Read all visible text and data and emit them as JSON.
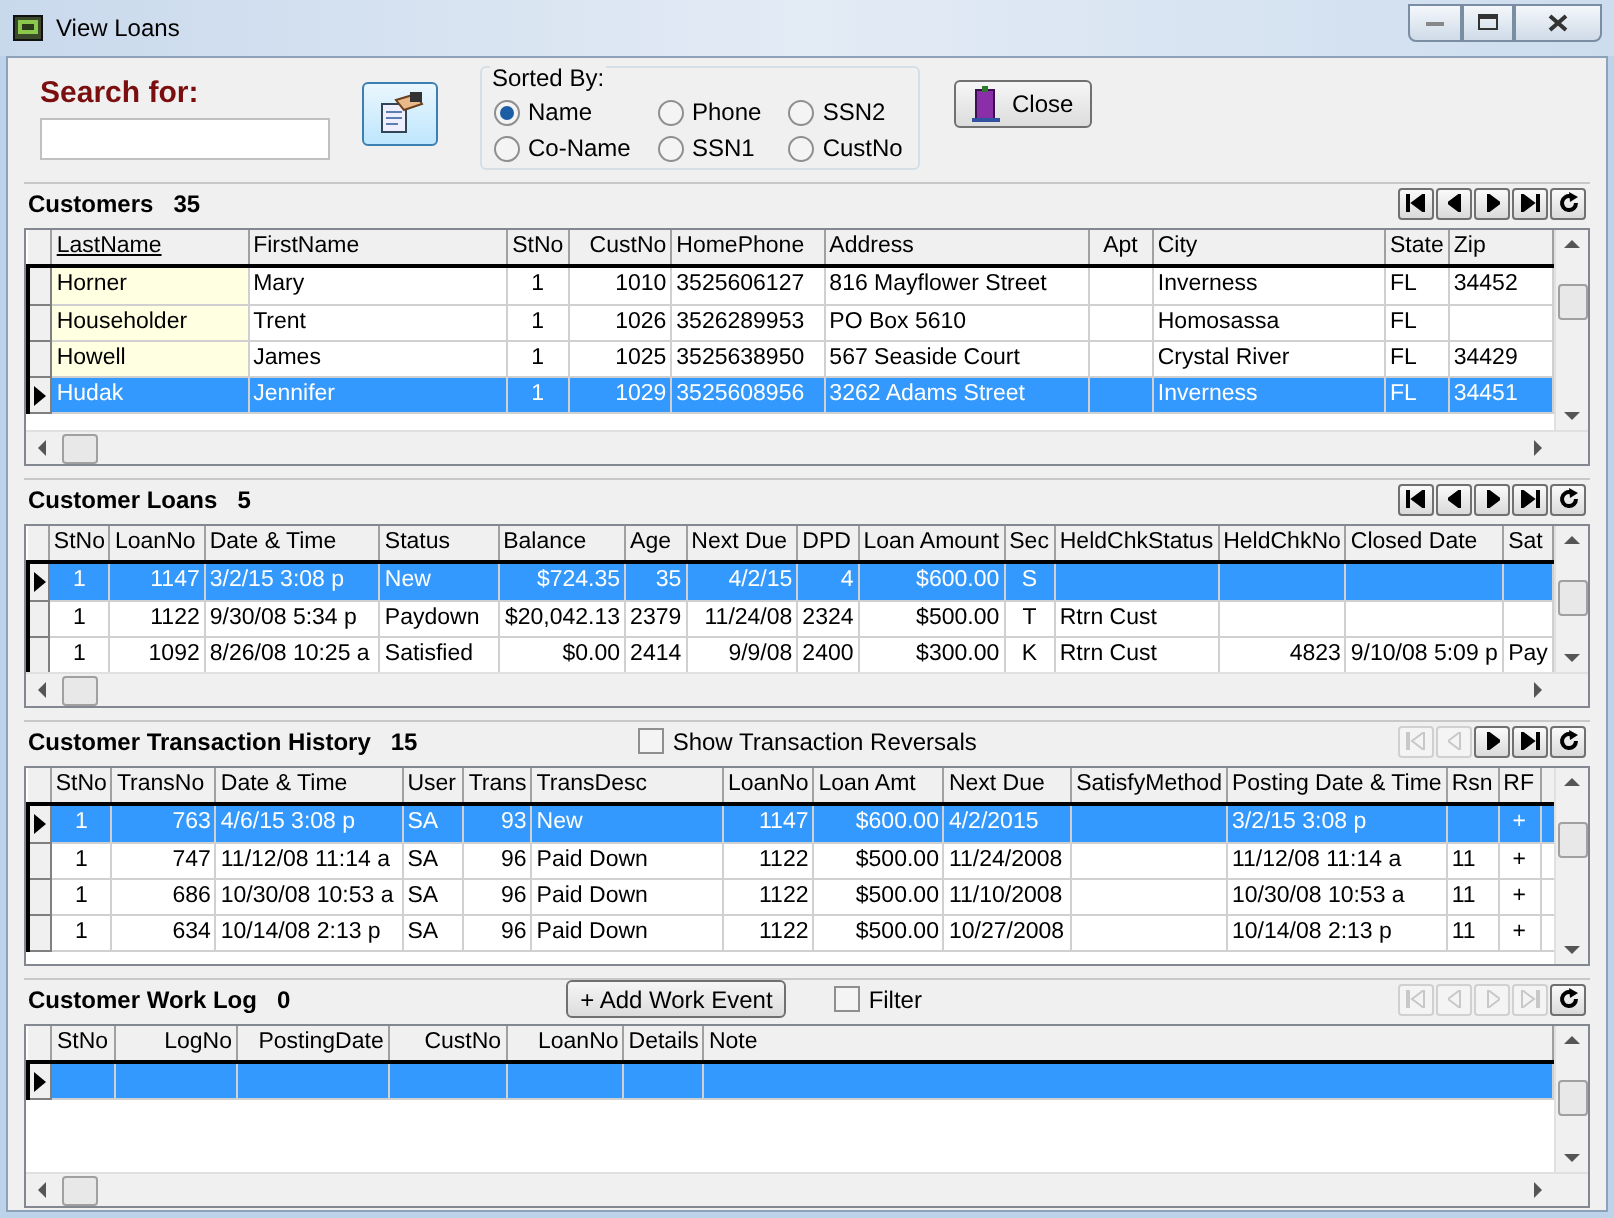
{
  "window": {
    "title": "View Loans"
  },
  "search": {
    "label": "Search for:"
  },
  "sort_group": {
    "title": "Sorted By:",
    "options": [
      {
        "label": "Name",
        "selected": true
      },
      {
        "label": "Co-Name",
        "selected": false
      },
      {
        "label": "Phone",
        "selected": false
      },
      {
        "label": "SSN1",
        "selected": false
      },
      {
        "label": "SSN2",
        "selected": false
      },
      {
        "label": "CustNo",
        "selected": false
      }
    ]
  },
  "close_button": {
    "label": "Close"
  },
  "sections": [
    {
      "title": "Customers",
      "count": "35",
      "nav": [
        {
          "kind": "first",
          "disabled": false
        },
        {
          "kind": "prev",
          "disabled": false
        },
        {
          "kind": "next",
          "disabled": false
        },
        {
          "kind": "last",
          "disabled": false
        },
        {
          "kind": "refresh",
          "disabled": false
        }
      ],
      "columns": [
        {
          "label": "LastName",
          "sorted": true
        },
        {
          "label": "FirstName",
          "sorted": false
        },
        {
          "label": "StNo",
          "sorted": false
        },
        {
          "label": "CustNo",
          "sorted": false
        },
        {
          "label": "HomePhone",
          "sorted": false
        },
        {
          "label": "Address",
          "sorted": false
        },
        {
          "label": "Apt",
          "sorted": false
        },
        {
          "label": "City",
          "sorted": false
        },
        {
          "label": "State",
          "sorted": false
        },
        {
          "label": "Zip",
          "sorted": false
        }
      ],
      "rows": [
        {
          "selected": false,
          "cells": [
            "Horner",
            "Mary",
            "1",
            "1010",
            "3525606127",
            "816 Mayflower Street",
            null,
            "Inverness",
            "FL",
            "34452"
          ]
        },
        {
          "selected": false,
          "cells": [
            "Householder",
            "Trent",
            "1",
            "1026",
            "3526289953",
            "PO Box 5610",
            null,
            "Homosassa",
            "FL",
            null
          ]
        },
        {
          "selected": false,
          "cells": [
            "Howell",
            "James",
            "1",
            "1025",
            "3525638950",
            "567 Seaside Court",
            null,
            "Crystal River",
            "FL",
            "34429"
          ]
        },
        {
          "selected": true,
          "cells": [
            "Hudak",
            "Jennifer",
            "1",
            "1029",
            "3525608956",
            "3262 Adams Street",
            null,
            "Inverness",
            "FL",
            "34451"
          ]
        }
      ]
    },
    {
      "title": "Customer Loans",
      "count": "5",
      "nav": [
        {
          "kind": "first",
          "disabled": false
        },
        {
          "kind": "prev",
          "disabled": false
        },
        {
          "kind": "next",
          "disabled": false
        },
        {
          "kind": "last",
          "disabled": false
        },
        {
          "kind": "refresh",
          "disabled": false
        }
      ],
      "columns": [
        {
          "label": "StNo"
        },
        {
          "label": "LoanNo"
        },
        {
          "label": "Date & Time"
        },
        {
          "label": "Status"
        },
        {
          "label": "Balance"
        },
        {
          "label": "Age"
        },
        {
          "label": "Next Due"
        },
        {
          "label": "DPD"
        },
        {
          "label": "Loan Amount"
        },
        {
          "label": "Sec"
        },
        {
          "label": "HeldChkStatus"
        },
        {
          "label": "HeldChkNo"
        },
        {
          "label": "Closed Date"
        },
        {
          "label": "Sat"
        }
      ],
      "rows": [
        {
          "selected": true,
          "cells": [
            "1",
            "1147",
            "3/2/15 3:08 p",
            "New",
            "$724.35",
            "35",
            "4/2/15",
            "4",
            "$600.00",
            "S",
            null,
            null,
            null,
            null
          ]
        },
        {
          "selected": false,
          "cells": [
            "1",
            "1122",
            "9/30/08 5:34 p",
            "Paydown",
            "$20,042.13",
            "2379",
            "11/24/08",
            "2324",
            "$500.00",
            "T",
            "Rtrn Cust",
            null,
            null,
            null
          ]
        },
        {
          "selected": false,
          "cells": [
            "1",
            "1092",
            "8/26/08 10:25 a",
            "Satisfied",
            "$0.00",
            "2414",
            "9/9/08",
            "2400",
            "$300.00",
            "K",
            "Rtrn Cust",
            "4823",
            "9/10/08 5:09 p",
            "Pay"
          ]
        }
      ]
    },
    {
      "title": "Customer Transaction History",
      "count": "15",
      "controls": [
        {
          "kind": "checkbox",
          "label": "Show Transaction Reversals",
          "checked": false
        }
      ],
      "nav": [
        {
          "kind": "first",
          "disabled": true
        },
        {
          "kind": "prev",
          "disabled": true
        },
        {
          "kind": "next",
          "disabled": false
        },
        {
          "kind": "last",
          "disabled": false
        },
        {
          "kind": "refresh",
          "disabled": false
        }
      ],
      "columns": [
        {
          "label": "StNo"
        },
        {
          "label": "TransNo"
        },
        {
          "label": "Date & Time"
        },
        {
          "label": "User"
        },
        {
          "label": "Trans"
        },
        {
          "label": "TransDesc"
        },
        {
          "label": "LoanNo"
        },
        {
          "label": "Loan Amt"
        },
        {
          "label": "Next Due"
        },
        {
          "label": "SatisfyMethod"
        },
        {
          "label": "Posting Date & Time"
        },
        {
          "label": "Rsn"
        },
        {
          "label": "RF"
        }
      ],
      "rows": [
        {
          "selected": true,
          "cells": [
            "1",
            "763",
            "4/6/15 3:08 p",
            "SA",
            "93",
            "New",
            "1147",
            "$600.00",
            "4/2/2015",
            null,
            "3/2/15 3:08 p",
            null,
            "+"
          ]
        },
        {
          "selected": false,
          "cells": [
            "1",
            "747",
            "11/12/08 11:14 a",
            "SA",
            "96",
            "Paid Down",
            "1122",
            "$500.00",
            "11/24/2008",
            null,
            "11/12/08 11:14 a",
            "11",
            "+"
          ]
        },
        {
          "selected": false,
          "cells": [
            "1",
            "686",
            "10/30/08 10:53 a",
            "SA",
            "96",
            "Paid Down",
            "1122",
            "$500.00",
            "11/10/2008",
            null,
            "10/30/08 10:53 a",
            "11",
            "+"
          ]
        },
        {
          "selected": false,
          "cells": [
            "1",
            "634",
            "10/14/08 2:13 p",
            "SA",
            "96",
            "Paid Down",
            "1122",
            "$500.00",
            "10/27/2008",
            null,
            "10/14/08 2:13 p",
            "11",
            "+"
          ]
        }
      ]
    },
    {
      "title": "Customer Work Log",
      "count": "0",
      "controls": [
        {
          "kind": "button",
          "label": "+ Add Work Event"
        },
        {
          "kind": "checkbox",
          "label": "Filter",
          "checked": false
        }
      ],
      "nav": [
        {
          "kind": "first",
          "disabled": true
        },
        {
          "kind": "prev",
          "disabled": true
        },
        {
          "kind": "next",
          "disabled": true
        },
        {
          "kind": "last",
          "disabled": true
        },
        {
          "kind": "refresh",
          "disabled": false
        }
      ],
      "columns": [
        {
          "label": "StNo"
        },
        {
          "label": "LogNo"
        },
        {
          "label": "PostingDate"
        },
        {
          "label": "CustNo"
        },
        {
          "label": "LoanNo"
        },
        {
          "label": "Details"
        },
        {
          "label": "Note"
        }
      ],
      "rows": [
        {
          "selected": true
        }
      ]
    }
  ]
}
